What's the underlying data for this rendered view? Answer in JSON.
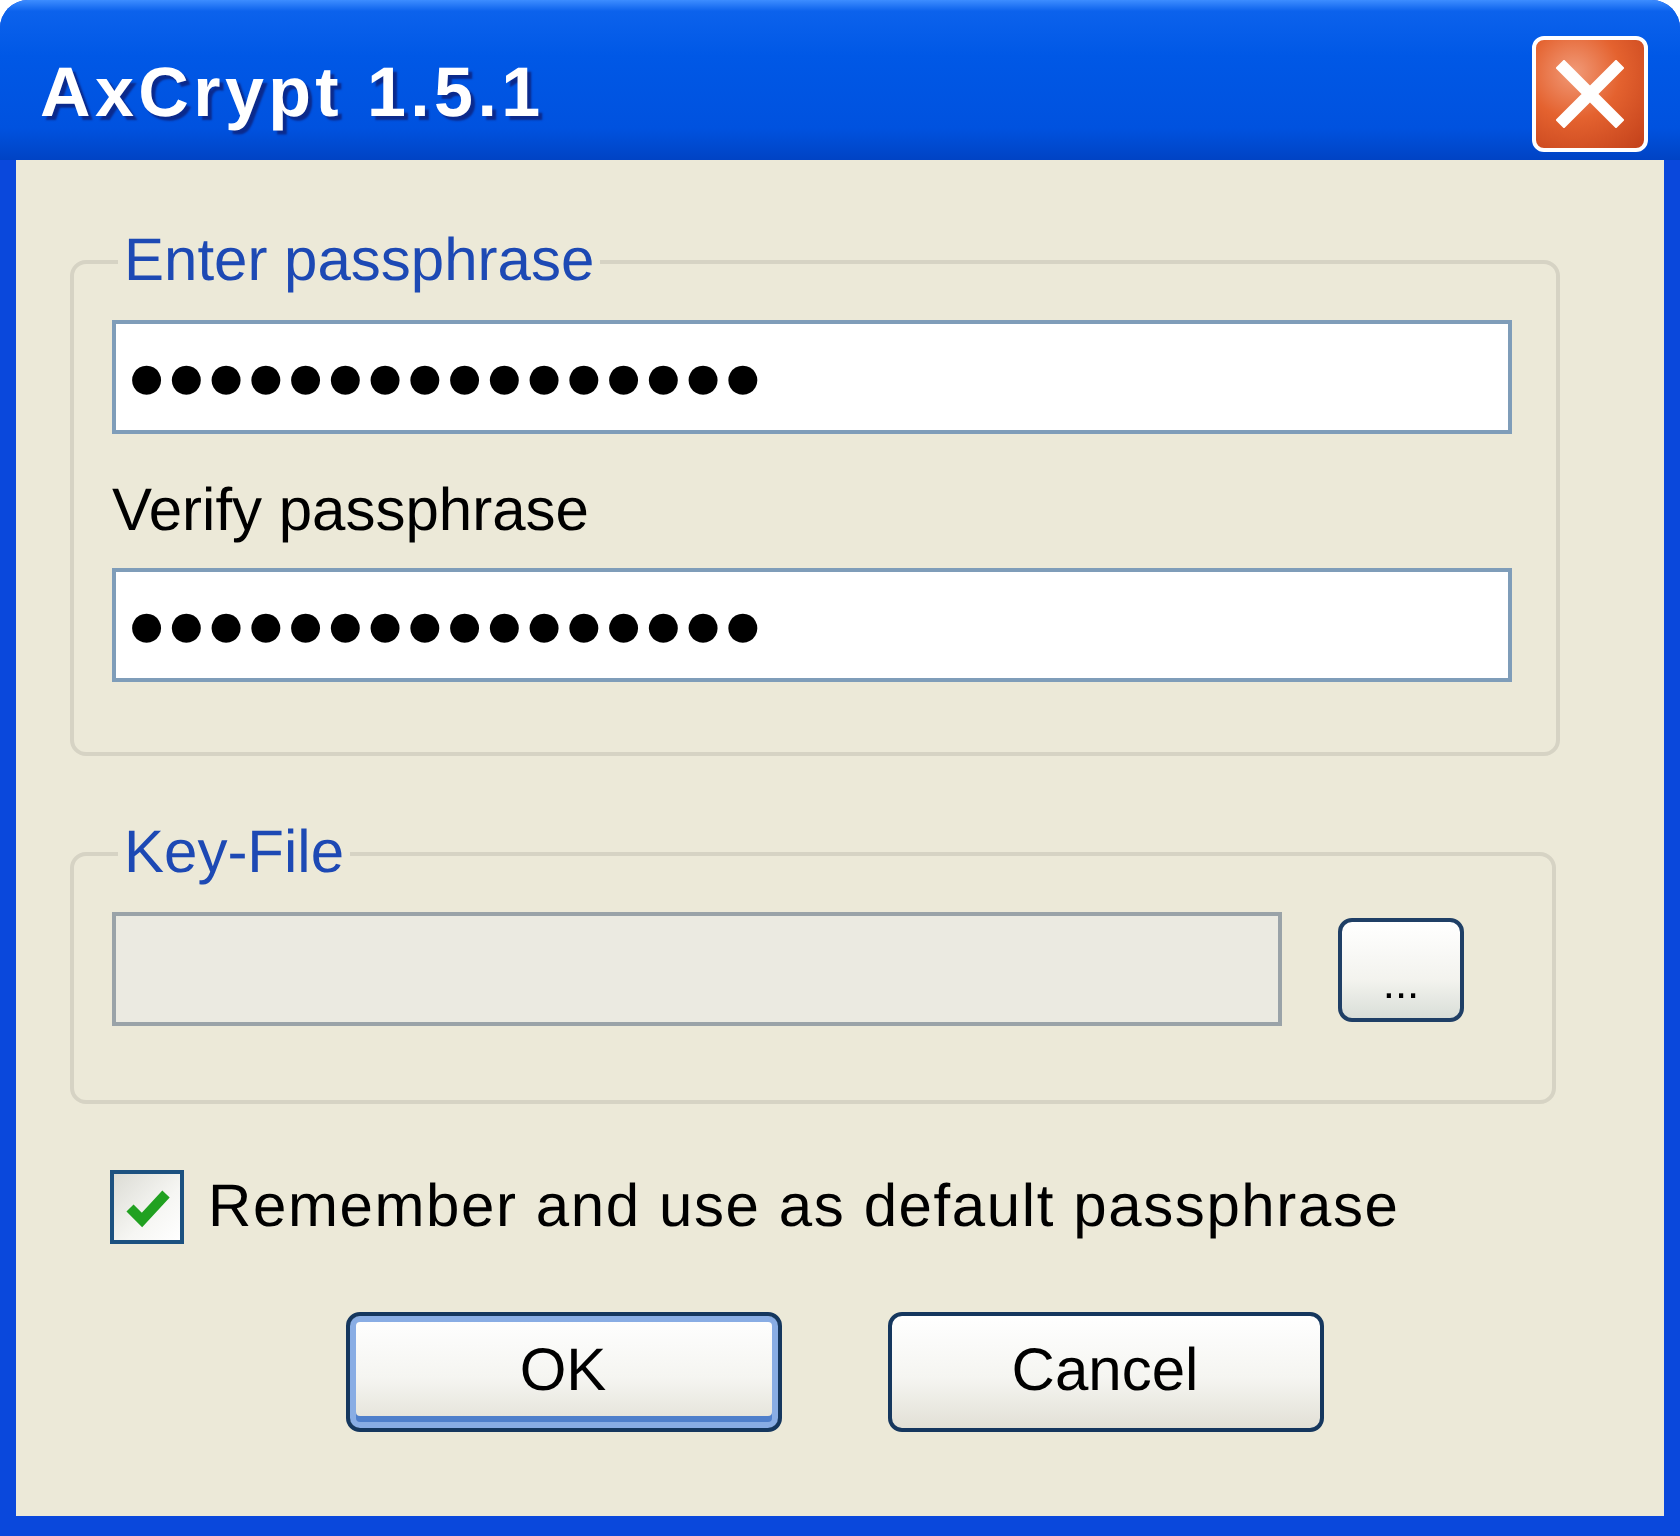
{
  "window": {
    "title": "AxCrypt 1.5.1"
  },
  "passphrase_group": {
    "legend": "Enter passphrase",
    "passphrase_field": {
      "value": "●●●●●●●●●●●●●●●●"
    },
    "verify_label": "Verify passphrase",
    "verify_field": {
      "value": "●●●●●●●●●●●●●●●●"
    }
  },
  "key_file_group": {
    "legend": "Key-File",
    "key_file_field": {
      "disabled": true
    },
    "browse_button": {
      "label": "..."
    }
  },
  "remember_checkbox": {
    "label": "Remember and use as default passphrase",
    "checked": true
  },
  "buttons": [
    {
      "label": "OK",
      "default": true
    },
    {
      "label": "Cancel",
      "default": false
    }
  ]
}
